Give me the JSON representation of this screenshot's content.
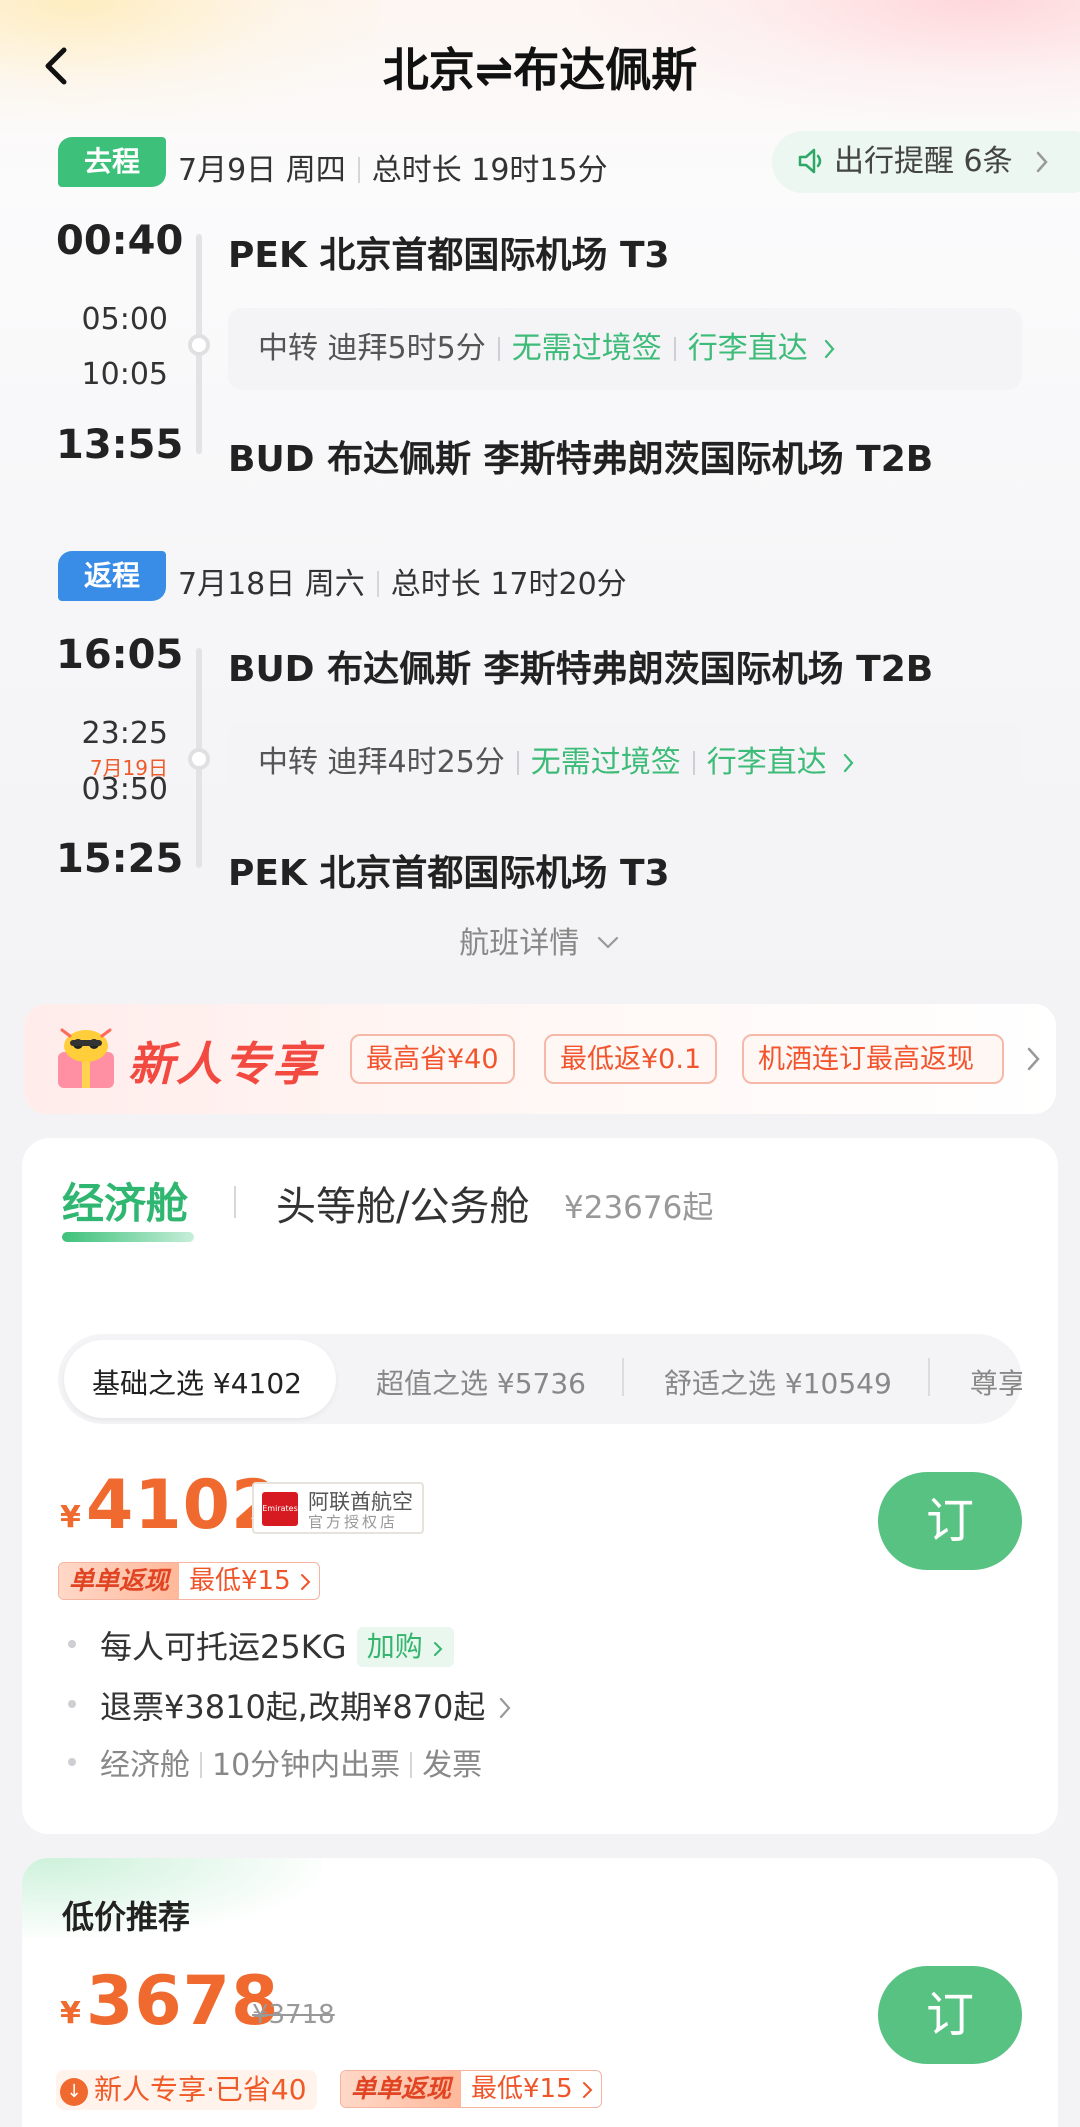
{
  "header": {
    "title": "北京⇌布达佩斯"
  },
  "outbound": {
    "tag": "去程",
    "date": "7月9日 周四",
    "duration": "总时长 19时15分",
    "depart_time": "00:40",
    "arrive_time": "13:55",
    "transfer_arrive": "05:00",
    "transfer_depart": "10:05",
    "depart_airport": "PEK 北京首都国际机场 T3",
    "arrive_airport": "BUD 布达佩斯 李斯特弗朗茨国际机场 T2B",
    "transfer_text": "中转 迪拜5时5分",
    "visa": "无需过境签",
    "luggage": "行李直达"
  },
  "reminder": {
    "text": "出行提醒 6条"
  },
  "inbound": {
    "tag": "返程",
    "date": "7月18日 周六",
    "duration": "总时长 17时20分",
    "depart_time": "16:05",
    "arrive_time": "15:25",
    "transfer_arrive": "23:25",
    "transfer_next_day": "7月19日",
    "transfer_depart": "03:50",
    "depart_airport": "BUD 布达佩斯 李斯特弗朗茨国际机场 T2B",
    "arrive_airport": "PEK 北京首都国际机场 T3",
    "transfer_text": "中转 迪拜4时25分",
    "visa": "无需过境签",
    "luggage": "行李直达"
  },
  "flight_detail": "航班详情",
  "promo": {
    "title": "新人专享",
    "chips": [
      "最高省¥40",
      "最低返¥0.1",
      "机酒连订最高返现"
    ]
  },
  "cabins": {
    "economy": "经济舱",
    "first_business": "头等舱/公务舱",
    "first_business_price": "¥23676起"
  },
  "fare_tabs": [
    {
      "label": "基础之选",
      "price": "¥4102"
    },
    {
      "label": "超值之选",
      "price": "¥5736"
    },
    {
      "label": "舒适之选",
      "price": "¥10549"
    },
    {
      "label": "尊享",
      "price": ""
    }
  ],
  "offer": {
    "currency": "¥",
    "price": "4102",
    "airline": "阿联酋航空",
    "airline_sub": "官方授权店",
    "airline_logo_text": "Emirates",
    "cashback_label": "单单返现",
    "cashback_value": "最低¥15",
    "book": "订",
    "baggage": "每人可托运25KG",
    "addon": "加购",
    "refund": "退票¥3810起,改期¥870起",
    "cabin_note": "经济舱",
    "ticketing": "10分钟内出票",
    "invoice": "发票"
  },
  "low_price": {
    "title": "低价推荐",
    "currency": "¥",
    "price": "3678",
    "original": "¥3718",
    "newuser": "新人专享·已省40",
    "cashback_label": "单单返现",
    "cashback_value": "最低¥15",
    "book": "订"
  },
  "colors": {
    "green": "#3dc17a",
    "blue": "#3a8de6",
    "orange": "#f06a30",
    "book_button": "#58c283"
  }
}
